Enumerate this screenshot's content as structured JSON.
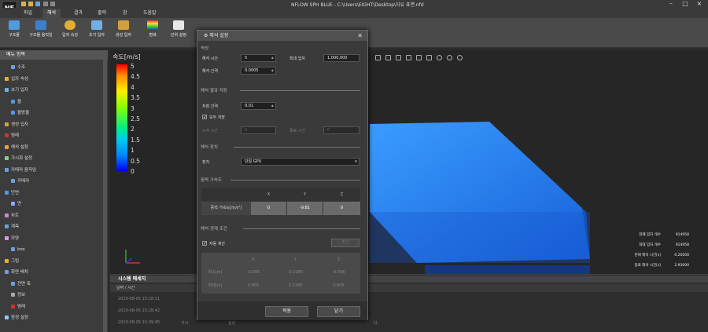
{
  "window": {
    "title": "NFLOW SPH BLUE - C:\\Users\\EIGHT\\Desktop\\자유 표면.nfd",
    "logo_text": "NF"
  },
  "menu": {
    "tabs": [
      "파일",
      "해석",
      "결과",
      "출력",
      "창",
      "도움말"
    ],
    "active": 1
  },
  "ribbon": {
    "buttons": [
      "구조물",
      "구조물 움직임",
      "입자 속성",
      "초기 입자",
      "생성 입자",
      "범례",
      "단위 설정"
    ]
  },
  "left_panel": {
    "header": "메뉴 항목",
    "items": [
      "수조",
      "입자 속성",
      "초기 입자",
      "블",
      "물방울",
      "생성 입자",
      "범례",
      "해석 설정",
      "가시화 설정",
      "카메라 움직임",
      "카메라",
      "단면",
      "면",
      "차트",
      "계측",
      "모양",
      "box",
      "그림",
      "화면 배치",
      "전면 축",
      "정보",
      "범례",
      "환경 설정"
    ]
  },
  "colorbar": {
    "title": "속도[m/s]",
    "labels": [
      "5",
      "4.5",
      "4",
      "3.5",
      "3",
      "2.5",
      "2",
      "1.5",
      "1",
      "0.5",
      "0"
    ]
  },
  "stats": [
    {
      "label": "현재 입자 개수",
      "value": "914958"
    },
    {
      "label": "최대 입자 개수",
      "value": "914958"
    },
    {
      "label": "현재 해석 시간[s]",
      "value": "0.20000"
    },
    {
      "label": "종료 해석 시간[s]",
      "value": "2.93000"
    }
  ],
  "system_log": {
    "title": "시스템 메세지",
    "col_datetime": "날짜 / 시간",
    "rows": [
      "2019-08-05 15:28:11",
      "2019-08-05 15:28:42",
      "2019-08-05 15:39:45"
    ],
    "trailing_fragment": "다.",
    "fragment2": "가시",
    "fragment3": "설정"
  },
  "dialog": {
    "title": "해석 설정",
    "sec_props": "속성",
    "analysis_time_label": "해석 시간",
    "analysis_time_value": "5",
    "max_particles_label": "최대 입자",
    "max_particles_value": "1,000,000",
    "interval_label": "해석 간격",
    "interval_value": "0.0005",
    "sec_save": "해석 결과 저장",
    "save_interval_label": "저장 간격",
    "save_interval_value": "0.01",
    "save_all_label": "모두 저장",
    "start_time_label": "시작 시간",
    "start_time_value": "0",
    "end_time_label": "종료 시간",
    "end_time_value": "0",
    "sec_device": "해석 장치",
    "device_label": "장치",
    "device_value": "단일 GPU",
    "sec_gravity": "중력 가속도",
    "gravity_cols": [
      "X",
      "Y",
      "Z"
    ],
    "gravity_label": "중력 가속도[m/s²]",
    "gravity_values": [
      "0",
      "-9.81",
      "0"
    ],
    "sec_bounds": "해석 경계 조건",
    "auto_calc_label": "자동 계산",
    "bounds_button": "초기",
    "bounds_cols": [
      "X",
      "Y",
      "Z"
    ],
    "min_label": "최소[m]",
    "max_label": "최대[m]",
    "min_values": [
      "-0.005",
      "-0.2285",
      "-0.006"
    ],
    "max_values": [
      "0.805",
      "2.1185",
      "0.605"
    ],
    "apply_button": "적용",
    "close_button": "닫기"
  }
}
